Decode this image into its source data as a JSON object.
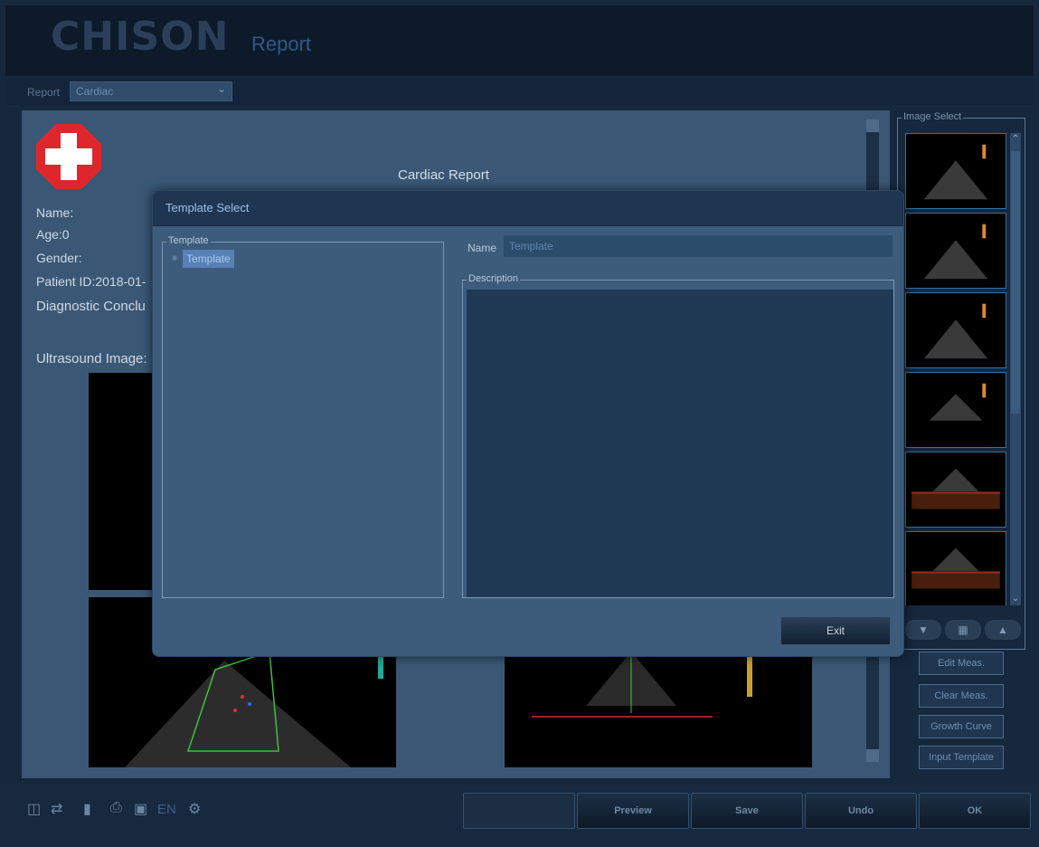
{
  "header": {
    "brand": "CHISON",
    "title": "Report"
  },
  "report_select": {
    "label": "Report",
    "value": "Cardiac"
  },
  "report": {
    "heading": "Cardiac Report",
    "fields": [
      "Name:",
      "Age:0",
      "Gender:",
      "Patient ID:2018-01-",
      "Diagnostic Conclu"
    ],
    "images_label": "Ultrasound Image:"
  },
  "dialog": {
    "title": "Template Select",
    "template_group_label": "Template",
    "template_items": [
      "Template"
    ],
    "name_label": "Name",
    "name_value": "Template",
    "description_label": "Description",
    "exit_label": "Exit"
  },
  "image_select": {
    "label": "Image Select"
  },
  "side_buttons": [
    "Edit Meas.",
    "Clear Meas.",
    "Growth Curve",
    "Input Template"
  ],
  "status": {
    "language": "EN"
  },
  "bottom_buttons": [
    "Preview",
    "Save",
    "Undo",
    "OK"
  ],
  "colors": {
    "background": "#16283d",
    "dialog": "#3d5c7c",
    "selection": "#5680b6",
    "logo_red": "#e0262d"
  }
}
